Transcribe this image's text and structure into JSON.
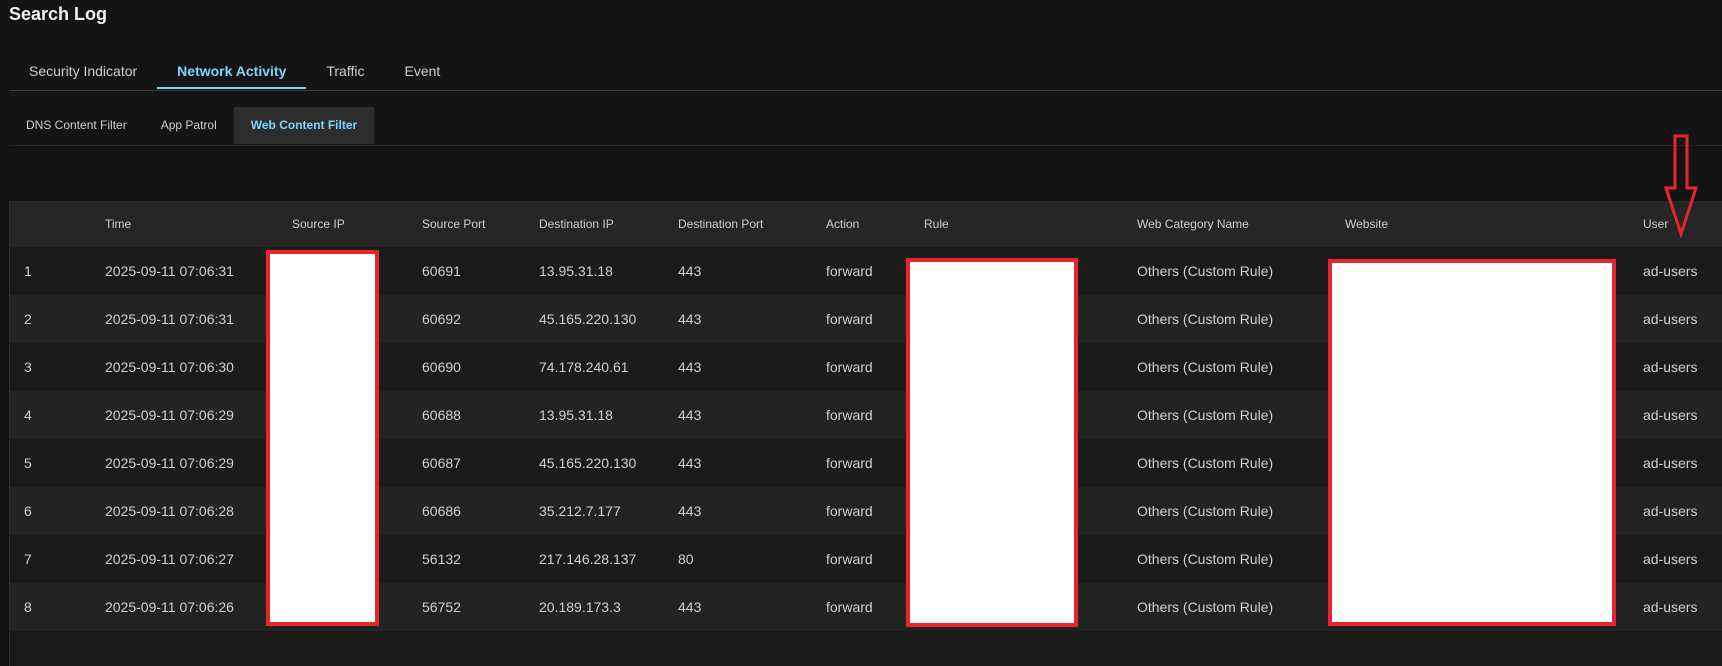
{
  "page": {
    "title": "Search Log"
  },
  "main_tabs": [
    {
      "label": "Security Indicator",
      "active": false
    },
    {
      "label": "Network Activity",
      "active": true
    },
    {
      "label": "Traffic",
      "active": false
    },
    {
      "label": "Event",
      "active": false
    }
  ],
  "sub_tabs": [
    {
      "label": "DNS Content Filter",
      "active": false
    },
    {
      "label": "App Patrol",
      "active": false
    },
    {
      "label": "Web Content Filter",
      "active": true
    }
  ],
  "table": {
    "columns": [
      "",
      "Time",
      "Source IP",
      "Source Port",
      "Destination IP",
      "Destination Port",
      "Action",
      "Rule",
      "Web Category Name",
      "Website",
      "User"
    ],
    "rows": [
      [
        "1",
        "2025-09-11 07:06:31",
        "",
        "60691",
        "13.95.31.18",
        "443",
        "forward",
        "",
        "Others (Custom Rule)",
        "",
        "ad-users"
      ],
      [
        "2",
        "2025-09-11 07:06:31",
        "",
        "60692",
        "45.165.220.130",
        "443",
        "forward",
        "",
        "Others (Custom Rule)",
        "",
        "ad-users"
      ],
      [
        "3",
        "2025-09-11 07:06:30",
        "",
        "60690",
        "74.178.240.61",
        "443",
        "forward",
        "",
        "Others (Custom Rule)",
        "",
        "ad-users"
      ],
      [
        "4",
        "2025-09-11 07:06:29",
        "",
        "60688",
        "13.95.31.18",
        "443",
        "forward",
        "",
        "Others (Custom Rule)",
        "",
        "ad-users"
      ],
      [
        "5",
        "2025-09-11 07:06:29",
        "",
        "60687",
        "45.165.220.130",
        "443",
        "forward",
        "",
        "Others (Custom Rule)",
        "",
        "ad-users"
      ],
      [
        "6",
        "2025-09-11 07:06:28",
        "",
        "60686",
        "35.212.7.177",
        "443",
        "forward",
        "",
        "Others (Custom Rule)",
        "",
        "ad-users"
      ],
      [
        "7",
        "2025-09-11 07:06:27",
        "",
        "56132",
        "217.146.28.137",
        "80",
        "forward",
        "",
        "Others (Custom Rule)",
        "",
        "ad-users"
      ],
      [
        "8",
        "2025-09-11 07:06:26",
        "",
        "56752",
        "20.189.173.3",
        "443",
        "forward",
        "",
        "Others (Custom Rule)",
        "",
        "ad-users"
      ]
    ]
  },
  "colors": {
    "accent": "#7fd4ff",
    "redaction_border": "#e5262e",
    "background": "#141414"
  },
  "annotations": [
    {
      "icon": "down-arrow-icon"
    }
  ]
}
